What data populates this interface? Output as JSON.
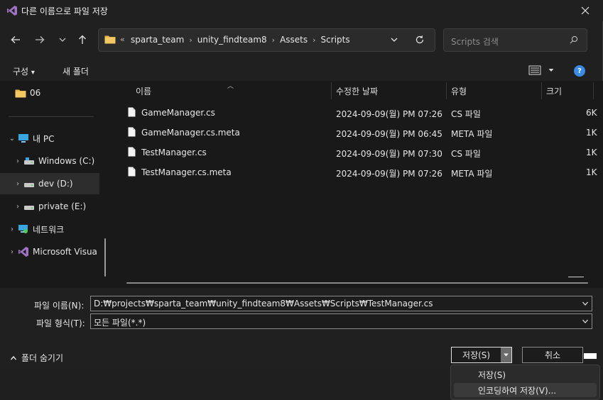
{
  "window": {
    "title": "다른 이름으로 파일 저장"
  },
  "address": {
    "overflow_chevrons": "«",
    "crumbs": [
      "sparta_team",
      "unity_findteam8",
      "Assets",
      "Scripts"
    ],
    "separator": "›"
  },
  "search": {
    "placeholder": "Scripts 검색"
  },
  "commands": {
    "organize": "구성",
    "organize_arrow": "▾",
    "new_folder": "새 폴더",
    "help": "?"
  },
  "nav": {
    "items": [
      {
        "label": "06",
        "icon": "folder-icon"
      },
      {
        "label": "내 PC",
        "icon": "pc-icon"
      },
      {
        "label": "Windows (C:)",
        "icon": "drive-icon"
      },
      {
        "label": "dev (D:)",
        "icon": "drive-icon"
      },
      {
        "label": "private (E:)",
        "icon": "drive-icon"
      },
      {
        "label": "네트워크",
        "icon": "network-icon"
      },
      {
        "label": "Microsoft Visua",
        "icon": "visual-studio-icon"
      }
    ]
  },
  "columns": {
    "name": "이름",
    "modified": "수정한 날짜",
    "type": "유형",
    "size": "크기"
  },
  "files": [
    {
      "name": "GameManager.cs",
      "modified": "2024-09-09(월) PM 07:26",
      "type": "CS 파일",
      "size": "6K"
    },
    {
      "name": "GameManager.cs.meta",
      "modified": "2024-09-09(월) PM 06:45",
      "type": "META 파일",
      "size": "1K"
    },
    {
      "name": "TestManager.cs",
      "modified": "2024-09-09(월) PM 07:30",
      "type": "CS 파일",
      "size": "1K"
    },
    {
      "name": "TestManager.cs.meta",
      "modified": "2024-09-09(월) PM 07:26",
      "type": "META 파일",
      "size": "1K"
    }
  ],
  "form": {
    "filename_label": "파일 이름(N):",
    "filename_value": "D:₩projects₩sparta_team₩unity_findteam8₩Assets₩Scripts₩TestManager.cs",
    "filetype_label": "파일 형식(T):",
    "filetype_value": "모든 파일(*.*)",
    "hide_folders": "폴더 숨기기",
    "save": "저장(S)",
    "cancel": "취소"
  },
  "menu": {
    "save": "저장(S)",
    "save_with_encoding": "인코딩하여 저장(V)..."
  },
  "colors": {
    "accent": "#3b8be6",
    "folder": "#e8b84a",
    "vs_purple": "#a074c4"
  }
}
